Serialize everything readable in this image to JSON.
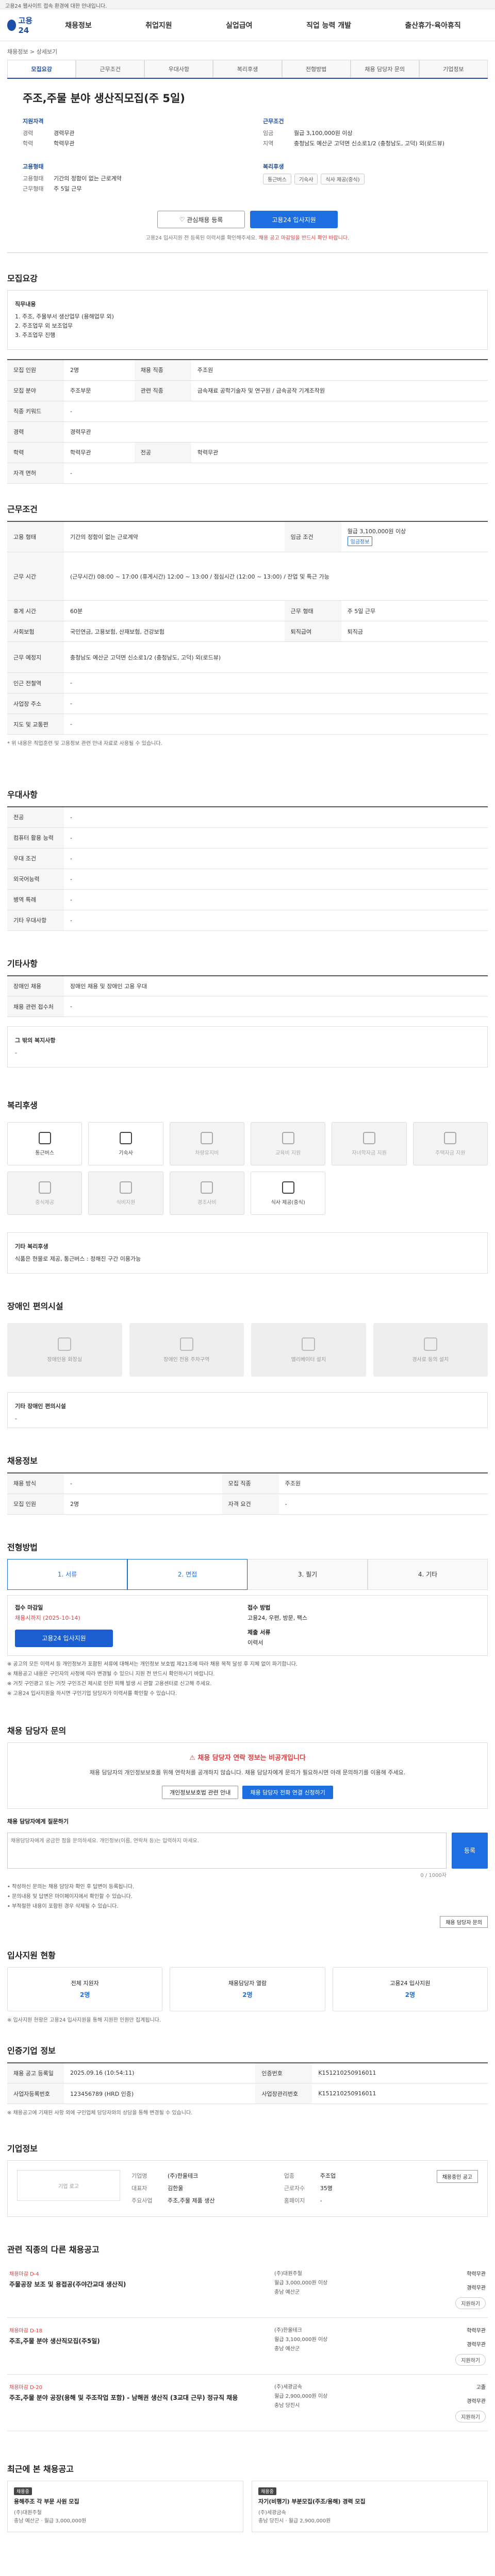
{
  "notice": "고용24 웹사이트 접속 환경에 대한 안내입니다.",
  "nav": {
    "logo": "고용24",
    "menu": [
      "채용정보",
      "취업지원",
      "실업급여",
      "직업 능력 개발",
      "출산휴가·육아휴직"
    ]
  },
  "breadcrumb": "채용정보 > 상세보기",
  "subtabs": [
    "모집요강",
    "근무조건",
    "우대사항",
    "복리후생",
    "전형방법",
    "채용 담당자 문의",
    "기업정보"
  ],
  "job_title": "주조,주물 분야 생산직모집(주 5일)",
  "summary": {
    "qual_title": "지원자격",
    "qual": [
      {
        "k": "경력",
        "v": "경력무관"
      },
      {
        "k": "학력",
        "v": "학력무관"
      }
    ],
    "cond_title": "근무조건",
    "cond": [
      {
        "k": "임금",
        "v": "월급 3,100,000원 이상"
      },
      {
        "k": "지역",
        "v": "충청남도 예산군 고덕면 신소로1/2 (충청남도, 고덕) 외(로드뷰)"
      }
    ],
    "type_title": "고용형태",
    "type": [
      {
        "k": "고용형태",
        "v": "기간의 정함이 없는 근로계약"
      },
      {
        "k": "근무형태",
        "v": "주 5일 근무"
      }
    ],
    "welfare_title": "복리후생",
    "welfare": [
      "통근버스",
      "기숙사",
      "식사 제공(중식)"
    ]
  },
  "buttons": {
    "scrap": "관심채용 등록",
    "apply": "고용24 입사지원"
  },
  "apply_tip": "고용24 입사지원 전 등록된 이력서를 확인해주세요.",
  "apply_tip_red": "채용 공고 마감일을 반드시 확인 바랍니다.",
  "recruit": {
    "title": "모집요강",
    "duty_title": "직무내용",
    "duties": [
      "1. 주조, 주물부서 생산업무 (용해업무 외)",
      "2. 주조업무 외 보조업무",
      "3. 주조업무 진행"
    ],
    "rows": [
      {
        "k": "모집 인원",
        "v": "2명",
        "k2": "채용 직종",
        "v2": "주조원"
      },
      {
        "k": "모집 분야",
        "v": "주조부문",
        "k2": "관련 직종",
        "v2": "금속재료 공학기술자 및 연구원 / 금속공작 기계조작원"
      },
      {
        "k": "직종 키워드",
        "v": "-",
        "k2": "",
        "v2": ""
      },
      {
        "k": "경력",
        "v": "경력무관",
        "k2": "",
        "v2": ""
      },
      {
        "k": "학력",
        "v": "학력무관",
        "k2": "전공",
        "v2": "학력무관"
      },
      {
        "k": "자격 면허",
        "v": "-",
        "k2": "",
        "v2": ""
      }
    ]
  },
  "conditions": {
    "title": "근무조건",
    "rows": [
      {
        "k": "고용 형태",
        "v": "기간의 정함이 없는 근로계약",
        "k2": "임금 조건",
        "v2": "월급 3,100,000원 이상",
        "tag": "임금정보"
      },
      {
        "k": "근무 시간",
        "v": "(근무시간) 08:00 ~ 17:00 (휴게시간) 12:00 ~ 13:00 / 점심시간 (12:00 ~ 13:00) / 잔업 및 특근 가능",
        "k2": "",
        "v2": ""
      },
      {
        "k": "휴게 시간",
        "v": "60분",
        "k2": "근무 형태",
        "v2": "주 5일 근무"
      },
      {
        "k": "사회보험",
        "v": "국민연금, 고용보험, 산재보험, 건강보험",
        "k2": "퇴직급여",
        "v2": "퇴직금"
      },
      {
        "k": "근무 예정지",
        "v": "충청남도 예산군 고덕면 신소로1/2 (충청남도, 고덕) 외(로드뷰)",
        "k2": "",
        "v2": ""
      },
      {
        "k": "인근 전철역",
        "v": "-",
        "k2": "",
        "v2": ""
      },
      {
        "k": "사업장 주소",
        "v": "-",
        "k2": "",
        "v2": ""
      },
      {
        "k": "지도 및 교통편",
        "v": "-",
        "k2": "",
        "v2": ""
      }
    ],
    "note": "* 위 내용은 직업훈련 및 고용정보 관련 안내 자료로 사용될 수 있습니다."
  },
  "prefer": {
    "title": "우대사항",
    "rows": [
      {
        "k": "전공",
        "v": "-"
      },
      {
        "k": "컴퓨터 활용 능력",
        "v": "-"
      },
      {
        "k": "우대 조건",
        "v": "-"
      },
      {
        "k": "외국어능력",
        "v": "-"
      },
      {
        "k": "병역 특례",
        "v": "-"
      },
      {
        "k": "기타 우대사항",
        "v": "-"
      }
    ]
  },
  "etc": {
    "title": "기타사항",
    "rows": [
      {
        "k": "장애인 채용",
        "v": "장애인 채용 및 장애인 고용 우대"
      },
      {
        "k": "채용 관련 접수처",
        "v": "-"
      }
    ],
    "extra_title": "그 밖의 복지사항",
    "extra": "-"
  },
  "welfare": {
    "title": "복리후생",
    "items": [
      {
        "label": "통근버스",
        "on": true
      },
      {
        "label": "기숙사",
        "on": true
      },
      {
        "label": "차량유지비",
        "on": false
      },
      {
        "label": "교육비 지원",
        "on": false
      },
      {
        "label": "자녀학자금 지원",
        "on": false
      },
      {
        "label": "주택자금 지원",
        "on": false
      },
      {
        "label": "중식제공",
        "on": false
      },
      {
        "label": "식비지원",
        "on": false
      },
      {
        "label": "경조사비",
        "on": false
      },
      {
        "label": "식사 제공(중식)",
        "on": true
      }
    ],
    "extra_title": "기타 복리후생",
    "extra": "식품은 현물로 제공, 통근버스 : 정해진 구간 이용가능"
  },
  "disabled": {
    "title": "장애인 편의시설",
    "items": [
      "장애인용 화장실",
      "장애인 전용 주차구역",
      "엘리베이터 설치",
      "경사로 등의 설치"
    ],
    "extra_title": "기타 장애인 편의시설",
    "extra": "-"
  },
  "company_info": {
    "title": "채용정보",
    "rows": [
      {
        "k": "채용 방식",
        "v": "-"
      },
      {
        "k": "모집 직종",
        "v": "주조원"
      },
      {
        "k": "모집 인원",
        "v": "2명"
      },
      {
        "k": "자격 요건",
        "v": "-"
      }
    ]
  },
  "process": {
    "title": "전형방법",
    "steps": [
      "1. 서류",
      "2. 면접",
      "3. 필기",
      "4. 기타"
    ],
    "deadline_label": "접수 마감일",
    "deadline": "채용시까지 (2025-10-14)",
    "apply_method_label": "접수 방법",
    "apply_method": "고용24, 우편, 방문, 팩스",
    "docs_label": "제출 서류",
    "docs": "이력서",
    "apply_btn": "고용24 입사지원"
  },
  "bullets": [
    "※ 공고의 모든 이력서 등 개인정보가 포함된 서류에 대해서는 개인정보 보호법 제21조에 따라 채용 목적 달성 후 지체 없이 파기합니다.",
    "※ 채용공고 내용은 구인자의 사정에 따라 변경될 수 있으니 지원 전 반드시 확인하시기 바랍니다.",
    "※ 거짓 구인광고 또는 거짓 구인조건 제시로 인한 피해 발생 시 관할 고용센터로 신고해 주세요.",
    "※ 고용24 입사지원을 하시면 구인기업 담당자가 이력서를 확인할 수 있습니다."
  ],
  "qa": {
    "title": "채용 담당자 문의",
    "warn": "채용 담당자 연락 정보는 비공개입니다",
    "body": "채용 담당자의 개인정보보호를 위해 연락처를 공개하지 않습니다. 채용 담당자에게 문의가 필요하시면 아래 문의하기를 이용해 주세요.",
    "btn1": "개인정보보호법 관련 안내",
    "btn2": "채용 담당자 전화 연결 신청하기",
    "label": "채용 담당자에게 질문하기",
    "placeholder": "채용담당자에게 궁금한 점을 문의하세요. 개인정보(이름, 연락처 등)는 입력하지 마세요.",
    "send": "등록",
    "count": "0 / 1000자"
  },
  "qa_notes": [
    "• 작성하신 문의는 채용 담당자 확인 후 답변이 등록됩니다.",
    "• 문의내용 및 답변은 마이페이지에서 확인할 수 있습니다.",
    "• 부적절한 내용이 포함된 경우 삭제될 수 있습니다."
  ],
  "qa_link": "채용 담당자 문의",
  "stats": {
    "title": "입사지원 현황",
    "items": [
      {
        "k": "전체 지원자",
        "v": "2명"
      },
      {
        "k": "채용담당자 열람",
        "v": "2명"
      },
      {
        "k": "고용24 입사지원",
        "v": "2명"
      }
    ],
    "note": "※ 입사지원 현황은 고용24 입사지원을 통해 지원한 인원만 집계됩니다."
  },
  "posting": {
    "title": "인증기업 정보",
    "rows": [
      {
        "k": "채용 공고 등록일",
        "v": "2025.09.16 (10:54:11)",
        "k2": "인증번호",
        "v2": "K151210250916011"
      },
      {
        "k": "사업자등록번호",
        "v": "123456789 (HRD 인증)",
        "k2": "사업장관리번호",
        "v2": "K151210250916011"
      }
    ],
    "note": "※ 채용공고에 기재된 사항 외에 구인업체 담당자와의 상담을 통해 변경될 수 있습니다."
  },
  "company": {
    "title": "기업정보",
    "logo": "기업 로고",
    "fields": [
      {
        "k": "기업명",
        "v": "(주)한울테크"
      },
      {
        "k": "업종",
        "v": "주조업"
      },
      {
        "k": "대표자",
        "v": "김한울"
      },
      {
        "k": "근로자수",
        "v": "35명"
      },
      {
        "k": "주요사업",
        "v": "주조,주물 제품 생산"
      },
      {
        "k": "홈페이지",
        "v": "-"
      }
    ],
    "btn": "채용중인 공고"
  },
  "related": {
    "title": "관련 직종의 다른 채용공고",
    "jobs": [
      {
        "label": "채용마감 D-4",
        "title": "주물공장 보조 및 용접공(주야간교대 생산직)",
        "company": "(주)대원주철",
        "wage": "월급 3,000,000원 이상",
        "loc": "충남 예산군",
        "edu": "학력무관",
        "career": "경력무관"
      },
      {
        "label": "채용마감 D-18",
        "title": "주조,주물 분야 생산직모집(주5일)",
        "company": "(주)한울테크",
        "wage": "월급 3,100,000원 이상",
        "loc": "충남 예산군",
        "edu": "학력무관",
        "career": "경력무관"
      },
      {
        "label": "채용마감 D-20",
        "title": "주조,주물 분야 공장(용해 및 주조작업 포함) - 남해권 생산직 (3교대 근무) 정규직 채용",
        "company": "(주)세광금속",
        "wage": "월급 2,900,000원 이상",
        "loc": "충남 당진시",
        "edu": "고졸",
        "career": "경력무관"
      }
    ],
    "apply": "지원하기"
  },
  "recent": {
    "title": "최근에 본 채용공고",
    "items": [
      {
        "badge": "채용중",
        "title": "용해주조 각 부문 사원 모집",
        "company": "(주)대원주철",
        "meta": "충남 예산군 · 월급 3,000,000원"
      },
      {
        "badge": "채용중",
        "title": "자기(비행기) 부분모집(주조/용해) 경력 모집",
        "company": "(주)세광금속",
        "meta": "충남 당진시 · 월급 2,900,000원"
      }
    ]
  }
}
